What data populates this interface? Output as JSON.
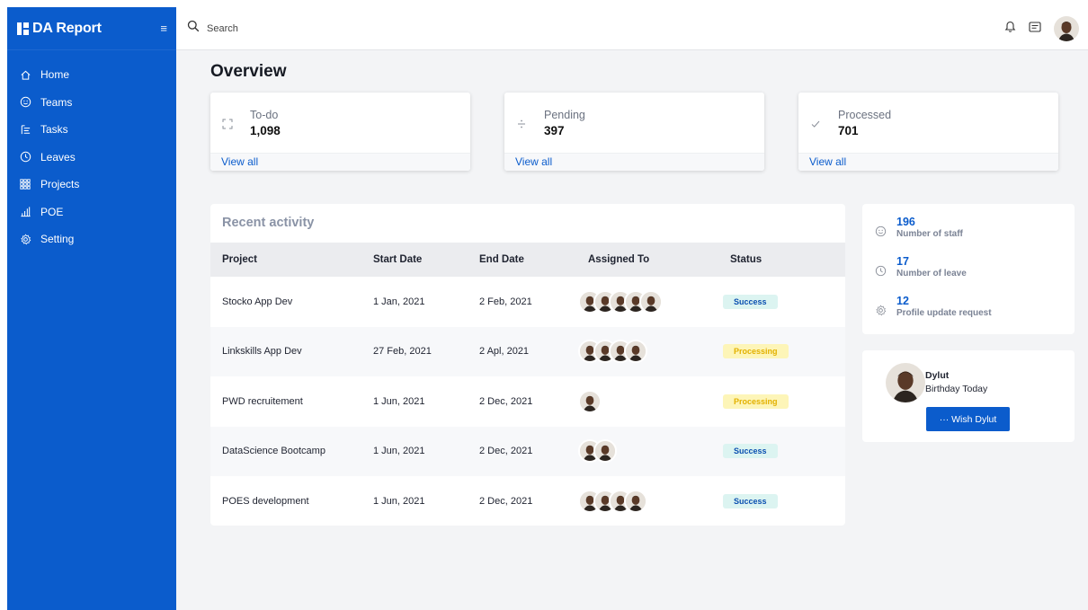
{
  "brand": {
    "title": "DA Report"
  },
  "sidebar": {
    "items": [
      {
        "label": "Home",
        "icon": "home-icon"
      },
      {
        "label": "Teams",
        "icon": "smiley-icon"
      },
      {
        "label": "Tasks",
        "icon": "tasks-icon"
      },
      {
        "label": "Leaves",
        "icon": "clock-icon"
      },
      {
        "label": "Projects",
        "icon": "grid-icon"
      },
      {
        "label": "POE",
        "icon": "bar-chart-icon"
      },
      {
        "label": "Setting",
        "icon": "gear-icon"
      }
    ]
  },
  "topbar": {
    "search_placeholder": "Search"
  },
  "overview": {
    "title": "Overview",
    "cards": [
      {
        "label": "To-do",
        "value": "1,098",
        "link": "View all",
        "icon": "expand-icon"
      },
      {
        "label": "Pending",
        "value": "397",
        "link": "View all",
        "icon": "divide-icon"
      },
      {
        "label": "Processed",
        "value": "701",
        "link": "View all",
        "icon": "check-icon"
      }
    ]
  },
  "activity": {
    "title": "Recent activity",
    "columns": [
      "Project",
      "Start Date",
      "End Date",
      "Assigned To",
      "Status"
    ],
    "rows": [
      {
        "project": "Stocko App Dev",
        "start": "1 Jan, 2021",
        "end": "2 Feb, 2021",
        "assignees": 5,
        "status": "Success"
      },
      {
        "project": "Linkskills App Dev",
        "start": "27 Feb, 2021",
        "end": "2 Apl, 2021",
        "assignees": 4,
        "status": "Processing"
      },
      {
        "project": "PWD recruitement",
        "start": "1 Jun, 2021",
        "end": "2 Dec, 2021",
        "assignees": 1,
        "status": "Processing"
      },
      {
        "project": "DataScience Bootcamp",
        "start": "1 Jun, 2021",
        "end": "2 Dec, 2021",
        "assignees": 2,
        "status": "Success"
      },
      {
        "project": "POES development",
        "start": "1 Jun, 2021",
        "end": "2 Dec, 2021",
        "assignees": 4,
        "status": "Success"
      }
    ]
  },
  "summary": {
    "items": [
      {
        "value": "196",
        "label": "Number of staff",
        "icon": "smiley-icon"
      },
      {
        "value": "17",
        "label": "Number of leave",
        "icon": "clock-icon"
      },
      {
        "value": "12",
        "label": "Profile update request",
        "icon": "gear-icon"
      }
    ]
  },
  "birthday": {
    "name": "Dylut",
    "subtitle": "Birthday Today",
    "button": "··· Wish Dylut"
  },
  "colors": {
    "primary": "#0b5ccc",
    "success_bg": "#dcf4f1",
    "processing_bg": "#fdf5b8",
    "processing_text": "#e3b100"
  }
}
